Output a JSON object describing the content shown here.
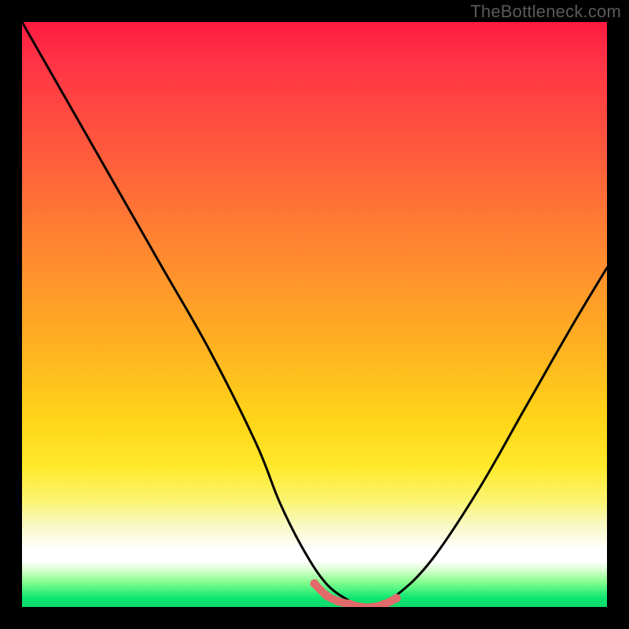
{
  "watermark": "TheBottleneck.com",
  "chart_data": {
    "type": "line",
    "title": "",
    "xlabel": "",
    "ylabel": "",
    "xlim": [
      0,
      100
    ],
    "ylim": [
      0,
      100
    ],
    "grid": false,
    "series": [
      {
        "name": "bottleneck-curve",
        "x": [
          0,
          8,
          16,
          24,
          32,
          40,
          44,
          48,
          52,
          56,
          58,
          60,
          64,
          70,
          78,
          86,
          94,
          100
        ],
        "values": [
          100,
          86,
          72,
          58,
          44,
          28,
          18,
          10,
          4,
          1,
          0,
          0,
          2,
          8,
          20,
          34,
          48,
          58
        ]
      },
      {
        "name": "trough-highlight",
        "color": "#e16a6a",
        "x": [
          50,
          52,
          54,
          56,
          58,
          60,
          62,
          64
        ],
        "values": [
          4,
          2,
          1,
          0.5,
          0,
          0,
          0.5,
          1.5
        ]
      }
    ],
    "background_gradient": {
      "stops": [
        {
          "pos": 0,
          "color": "#ff1a3f"
        },
        {
          "pos": 22,
          "color": "#ff5a3d"
        },
        {
          "pos": 40,
          "color": "#ff8a2f"
        },
        {
          "pos": 56,
          "color": "#ffb321"
        },
        {
          "pos": 76,
          "color": "#ffe92a"
        },
        {
          "pos": 86,
          "color": "#f8f8c4"
        },
        {
          "pos": 92,
          "color": "#ffffff"
        },
        {
          "pos": 96,
          "color": "#7fff88"
        },
        {
          "pos": 100,
          "color": "#00d860"
        }
      ]
    },
    "annotations": []
  }
}
